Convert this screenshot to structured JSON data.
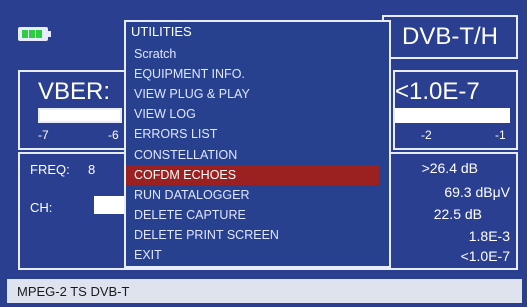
{
  "header": {
    "standard": "DVB-T/H"
  },
  "meter": {
    "label": "VBER:",
    "value": "<1.0E-7",
    "scale_left": [
      "-7",
      "-6"
    ],
    "scale_right": [
      "-2",
      "-1"
    ]
  },
  "measurements": {
    "freq_label": "FREQ:",
    "freq_partial": "8",
    "ch_label": "CH:",
    "values": [
      ">26.4 dB",
      "69.3 dBμV",
      "22.5 dB",
      "1.8E-3",
      "<1.0E-7"
    ]
  },
  "menu": {
    "title": "UTILITIES",
    "items": [
      {
        "label": "Scratch",
        "selected": false
      },
      {
        "label": "EQUIPMENT INFO.",
        "selected": false
      },
      {
        "label": "VIEW PLUG & PLAY",
        "selected": false
      },
      {
        "label": "VIEW LOG",
        "selected": false
      },
      {
        "label": "ERRORS LIST",
        "selected": false
      },
      {
        "label": "CONSTELLATION",
        "selected": false
      },
      {
        "label": "COFDM ECHOES",
        "selected": true
      },
      {
        "label": "RUN DATALOGGER",
        "selected": false
      },
      {
        "label": "DELETE CAPTURE",
        "selected": false
      },
      {
        "label": "DELETE PRINT SCREEN",
        "selected": false
      },
      {
        "label": "EXIT",
        "selected": false
      }
    ]
  },
  "status": {
    "stream": "MPEG-2 TS DVB-T"
  },
  "colors": {
    "screen_bg": "#2b3f91",
    "selected_item": "#9a2120",
    "battery": "#2ecc40"
  }
}
